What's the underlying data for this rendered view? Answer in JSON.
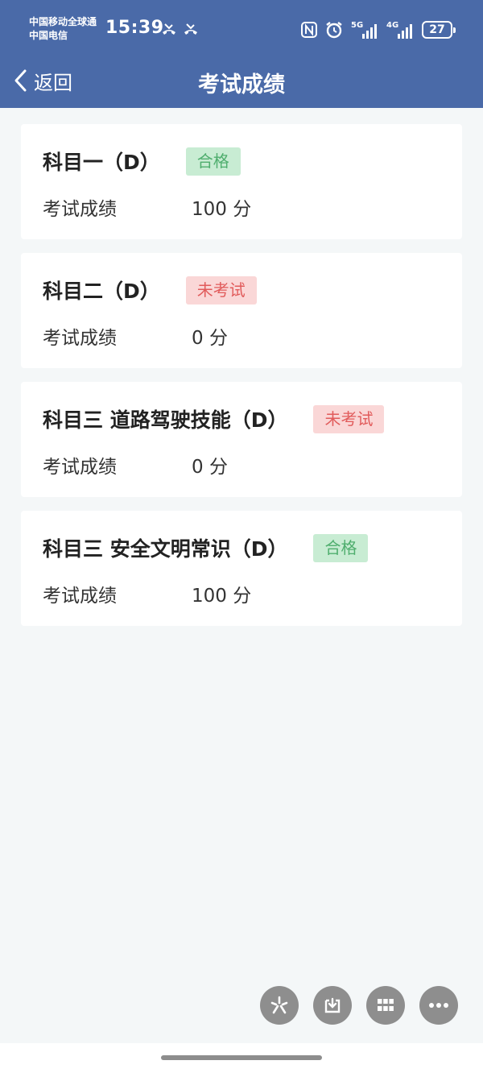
{
  "status_bar": {
    "carrier_line1": "中国移动全球通",
    "carrier_line2": "中国电信",
    "time": "15:39",
    "net1_label": "5G",
    "net2_label": "4G",
    "battery": "27",
    "icons": [
      "missed-call-icon",
      "missed-call-icon",
      "nfc-icon",
      "alarm-icon",
      "signal-icon",
      "signal-icon",
      "battery-icon"
    ]
  },
  "nav": {
    "back_label": "返回",
    "title": "考试成绩"
  },
  "colors": {
    "header_bg": "#4a6aa8",
    "pass_bg": "#c8ecd3",
    "pass_text": "#4fae6e",
    "fail_bg": "#fad7d7",
    "fail_text": "#e15b5b",
    "page_bg": "#f4f7f8"
  },
  "results": [
    {
      "subject": "科目一（D）",
      "status": "合格",
      "status_type": "pass",
      "score_label": "考试成绩",
      "score": "100 分"
    },
    {
      "subject": "科目二（D）",
      "status": "未考试",
      "status_type": "fail",
      "score_label": "考试成绩",
      "score": "0 分"
    },
    {
      "subject": "科目三 道路驾驶技能（D）",
      "status": "未考试",
      "status_type": "fail",
      "score_label": "考试成绩",
      "score": "0 分"
    },
    {
      "subject": "科目三 安全文明常识（D）",
      "status": "合格",
      "status_type": "pass",
      "score_label": "考试成绩",
      "score": "100 分"
    }
  ],
  "floating_buttons": [
    "sparkle-icon",
    "download-icon",
    "grid-icon",
    "more-icon"
  ]
}
